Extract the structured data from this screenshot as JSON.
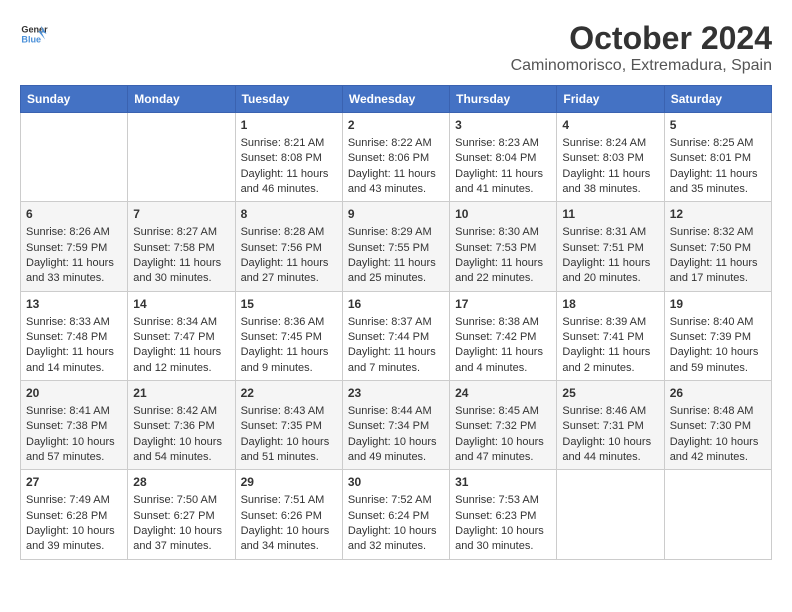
{
  "header": {
    "logo_line1": "General",
    "logo_line2": "Blue",
    "title": "October 2024",
    "subtitle": "Caminomorisco, Extremadura, Spain"
  },
  "weekdays": [
    "Sunday",
    "Monday",
    "Tuesday",
    "Wednesday",
    "Thursday",
    "Friday",
    "Saturday"
  ],
  "weeks": [
    [
      {
        "day": "",
        "sunrise": "",
        "sunset": "",
        "daylight": ""
      },
      {
        "day": "",
        "sunrise": "",
        "sunset": "",
        "daylight": ""
      },
      {
        "day": "1",
        "sunrise": "Sunrise: 8:21 AM",
        "sunset": "Sunset: 8:08 PM",
        "daylight": "Daylight: 11 hours and 46 minutes."
      },
      {
        "day": "2",
        "sunrise": "Sunrise: 8:22 AM",
        "sunset": "Sunset: 8:06 PM",
        "daylight": "Daylight: 11 hours and 43 minutes."
      },
      {
        "day": "3",
        "sunrise": "Sunrise: 8:23 AM",
        "sunset": "Sunset: 8:04 PM",
        "daylight": "Daylight: 11 hours and 41 minutes."
      },
      {
        "day": "4",
        "sunrise": "Sunrise: 8:24 AM",
        "sunset": "Sunset: 8:03 PM",
        "daylight": "Daylight: 11 hours and 38 minutes."
      },
      {
        "day": "5",
        "sunrise": "Sunrise: 8:25 AM",
        "sunset": "Sunset: 8:01 PM",
        "daylight": "Daylight: 11 hours and 35 minutes."
      }
    ],
    [
      {
        "day": "6",
        "sunrise": "Sunrise: 8:26 AM",
        "sunset": "Sunset: 7:59 PM",
        "daylight": "Daylight: 11 hours and 33 minutes."
      },
      {
        "day": "7",
        "sunrise": "Sunrise: 8:27 AM",
        "sunset": "Sunset: 7:58 PM",
        "daylight": "Daylight: 11 hours and 30 minutes."
      },
      {
        "day": "8",
        "sunrise": "Sunrise: 8:28 AM",
        "sunset": "Sunset: 7:56 PM",
        "daylight": "Daylight: 11 hours and 27 minutes."
      },
      {
        "day": "9",
        "sunrise": "Sunrise: 8:29 AM",
        "sunset": "Sunset: 7:55 PM",
        "daylight": "Daylight: 11 hours and 25 minutes."
      },
      {
        "day": "10",
        "sunrise": "Sunrise: 8:30 AM",
        "sunset": "Sunset: 7:53 PM",
        "daylight": "Daylight: 11 hours and 22 minutes."
      },
      {
        "day": "11",
        "sunrise": "Sunrise: 8:31 AM",
        "sunset": "Sunset: 7:51 PM",
        "daylight": "Daylight: 11 hours and 20 minutes."
      },
      {
        "day": "12",
        "sunrise": "Sunrise: 8:32 AM",
        "sunset": "Sunset: 7:50 PM",
        "daylight": "Daylight: 11 hours and 17 minutes."
      }
    ],
    [
      {
        "day": "13",
        "sunrise": "Sunrise: 8:33 AM",
        "sunset": "Sunset: 7:48 PM",
        "daylight": "Daylight: 11 hours and 14 minutes."
      },
      {
        "day": "14",
        "sunrise": "Sunrise: 8:34 AM",
        "sunset": "Sunset: 7:47 PM",
        "daylight": "Daylight: 11 hours and 12 minutes."
      },
      {
        "day": "15",
        "sunrise": "Sunrise: 8:36 AM",
        "sunset": "Sunset: 7:45 PM",
        "daylight": "Daylight: 11 hours and 9 minutes."
      },
      {
        "day": "16",
        "sunrise": "Sunrise: 8:37 AM",
        "sunset": "Sunset: 7:44 PM",
        "daylight": "Daylight: 11 hours and 7 minutes."
      },
      {
        "day": "17",
        "sunrise": "Sunrise: 8:38 AM",
        "sunset": "Sunset: 7:42 PM",
        "daylight": "Daylight: 11 hours and 4 minutes."
      },
      {
        "day": "18",
        "sunrise": "Sunrise: 8:39 AM",
        "sunset": "Sunset: 7:41 PM",
        "daylight": "Daylight: 11 hours and 2 minutes."
      },
      {
        "day": "19",
        "sunrise": "Sunrise: 8:40 AM",
        "sunset": "Sunset: 7:39 PM",
        "daylight": "Daylight: 10 hours and 59 minutes."
      }
    ],
    [
      {
        "day": "20",
        "sunrise": "Sunrise: 8:41 AM",
        "sunset": "Sunset: 7:38 PM",
        "daylight": "Daylight: 10 hours and 57 minutes."
      },
      {
        "day": "21",
        "sunrise": "Sunrise: 8:42 AM",
        "sunset": "Sunset: 7:36 PM",
        "daylight": "Daylight: 10 hours and 54 minutes."
      },
      {
        "day": "22",
        "sunrise": "Sunrise: 8:43 AM",
        "sunset": "Sunset: 7:35 PM",
        "daylight": "Daylight: 10 hours and 51 minutes."
      },
      {
        "day": "23",
        "sunrise": "Sunrise: 8:44 AM",
        "sunset": "Sunset: 7:34 PM",
        "daylight": "Daylight: 10 hours and 49 minutes."
      },
      {
        "day": "24",
        "sunrise": "Sunrise: 8:45 AM",
        "sunset": "Sunset: 7:32 PM",
        "daylight": "Daylight: 10 hours and 47 minutes."
      },
      {
        "day": "25",
        "sunrise": "Sunrise: 8:46 AM",
        "sunset": "Sunset: 7:31 PM",
        "daylight": "Daylight: 10 hours and 44 minutes."
      },
      {
        "day": "26",
        "sunrise": "Sunrise: 8:48 AM",
        "sunset": "Sunset: 7:30 PM",
        "daylight": "Daylight: 10 hours and 42 minutes."
      }
    ],
    [
      {
        "day": "27",
        "sunrise": "Sunrise: 7:49 AM",
        "sunset": "Sunset: 6:28 PM",
        "daylight": "Daylight: 10 hours and 39 minutes."
      },
      {
        "day": "28",
        "sunrise": "Sunrise: 7:50 AM",
        "sunset": "Sunset: 6:27 PM",
        "daylight": "Daylight: 10 hours and 37 minutes."
      },
      {
        "day": "29",
        "sunrise": "Sunrise: 7:51 AM",
        "sunset": "Sunset: 6:26 PM",
        "daylight": "Daylight: 10 hours and 34 minutes."
      },
      {
        "day": "30",
        "sunrise": "Sunrise: 7:52 AM",
        "sunset": "Sunset: 6:24 PM",
        "daylight": "Daylight: 10 hours and 32 minutes."
      },
      {
        "day": "31",
        "sunrise": "Sunrise: 7:53 AM",
        "sunset": "Sunset: 6:23 PM",
        "daylight": "Daylight: 10 hours and 30 minutes."
      },
      {
        "day": "",
        "sunrise": "",
        "sunset": "",
        "daylight": ""
      },
      {
        "day": "",
        "sunrise": "",
        "sunset": "",
        "daylight": ""
      }
    ]
  ]
}
